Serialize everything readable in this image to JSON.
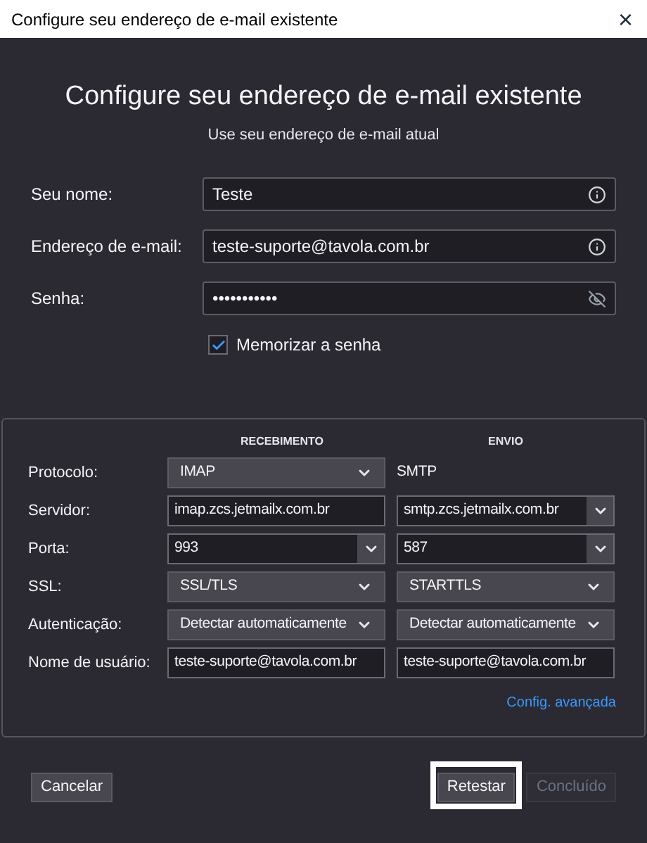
{
  "window": {
    "title": "Configure seu endereço de e-mail existente",
    "close": "×"
  },
  "heading": "Configure seu endereço de e-mail existente",
  "subheading": "Use seu endereço de e-mail atual",
  "fields": [
    {
      "label": "Seu nome:",
      "value": "Teste",
      "kind": "text"
    },
    {
      "label": "Endereço de e-mail:",
      "value": "teste-suporte@tavola.com.br",
      "kind": "text"
    },
    {
      "label": "Senha:",
      "value": "•••••••••••",
      "kind": "password"
    }
  ],
  "remember": {
    "label": "Memorizar a senha",
    "checked": true
  },
  "server_table": {
    "columns": [
      "RECEBIMENTO",
      "ENVIO"
    ],
    "rows": [
      {
        "label": "Protocolo:",
        "cells": [
          {
            "kind": "select",
            "value": "IMAP"
          },
          {
            "kind": "static",
            "value": "SMTP"
          }
        ]
      },
      {
        "label": "Servidor:",
        "cells": [
          {
            "kind": "text",
            "value": "imap.zcs.jetmailx.com.br"
          },
          {
            "kind": "combo",
            "value": "smtp.zcs.jetmailx.com.br"
          }
        ]
      },
      {
        "label": "Porta:",
        "cells": [
          {
            "kind": "combo",
            "value": "993"
          },
          {
            "kind": "combo",
            "value": "587"
          }
        ]
      },
      {
        "label": "SSL:",
        "cells": [
          {
            "kind": "select",
            "value": "SSL/TLS"
          },
          {
            "kind": "select",
            "value": "STARTTLS"
          }
        ]
      },
      {
        "label": "Autenticação:",
        "cells": [
          {
            "kind": "select",
            "value": "Detectar automaticamente"
          },
          {
            "kind": "select",
            "value": "Detectar automaticamente"
          }
        ]
      },
      {
        "label": "Nome de usuário:",
        "cells": [
          {
            "kind": "text",
            "value": "teste-suporte@tavola.com.br"
          },
          {
            "kind": "text",
            "value": "teste-suporte@tavola.com.br"
          }
        ]
      }
    ],
    "advanced_link": "Config. avançada"
  },
  "buttons": [
    {
      "label": "Cancelar",
      "disabled": false,
      "highlighted": false
    },
    {
      "label": "Retestar",
      "disabled": false,
      "highlighted": true
    },
    {
      "label": "Concluído",
      "disabled": true,
      "highlighted": false
    }
  ]
}
